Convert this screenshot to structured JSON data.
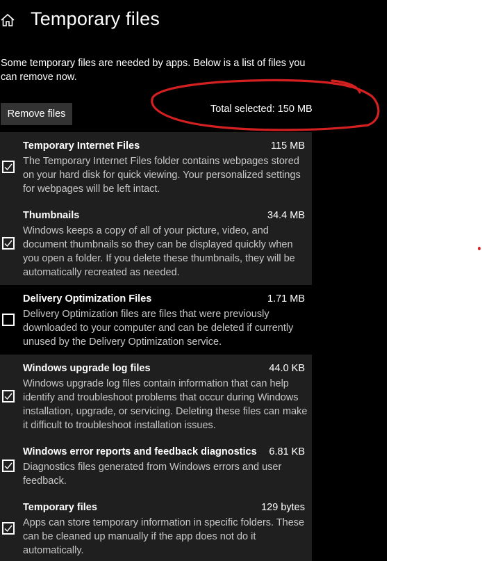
{
  "header": {
    "title": "Temporary files",
    "home_icon": "home-icon"
  },
  "description": "Some temporary files are needed by apps. Below is a list of files you can remove now.",
  "actions": {
    "remove_label": "Remove files",
    "total_selected": "Total selected: 150 MB"
  },
  "colors": {
    "panel_background": "#000000",
    "item_background": "#1f1f1f",
    "button_background": "#333333",
    "annotation": "#d42020"
  },
  "items": [
    {
      "name": "Temporary Internet Files",
      "size": "115 MB",
      "checked": true,
      "description": "The Temporary Internet Files folder contains webpages stored on your hard disk for quick viewing. Your personalized settings for webpages will be left intact."
    },
    {
      "name": "Thumbnails",
      "size": "34.4 MB",
      "checked": true,
      "description": "Windows keeps a copy of all of your picture, video, and document thumbnails so they can be displayed quickly when you open a folder. If you delete these thumbnails, they will be automatically recreated as needed."
    },
    {
      "name": "Delivery Optimization Files",
      "size": "1.71 MB",
      "checked": false,
      "description": "Delivery Optimization files are files that were previously downloaded to your computer and can be deleted if currently unused by the Delivery Optimization service."
    },
    {
      "name": "Windows upgrade log files",
      "size": "44.0 KB",
      "checked": true,
      "description": "Windows upgrade log files contain information that can help identify and troubleshoot problems that occur during Windows installation, upgrade, or servicing.  Deleting these files can make it difficult to troubleshoot installation issues."
    },
    {
      "name": "Windows error reports and feedback diagnostics",
      "size": "6.81 KB",
      "checked": true,
      "description": "Diagnostics files generated from Windows errors and user feedback."
    },
    {
      "name": "Temporary files",
      "size": "129 bytes",
      "checked": true,
      "description": "Apps can store temporary information in specific folders. These can be cleaned up manually if the app does not do it automatically."
    }
  ]
}
